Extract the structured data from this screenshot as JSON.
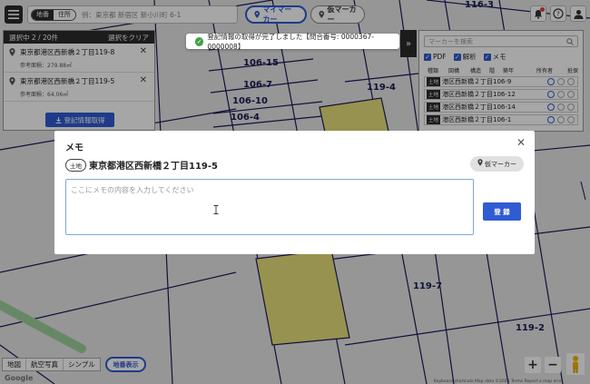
{
  "topbar": {
    "map_toggle": "地番",
    "address_toggle": "住所",
    "search_placeholder": "例：東京都 新宿区 新小川町 6-1",
    "my_marker": "マイマーカー",
    "temp_marker": "仮マーカー"
  },
  "map_labels": [
    "116-3",
    "106-15",
    "106-7",
    "106-10",
    "106-4",
    "119-4",
    "119-7",
    "119-2"
  ],
  "selection_panel": {
    "title": "選択中 2 / 20件",
    "clear": "選択をクリア",
    "items": [
      {
        "address": "東京都港区西新橋２丁目119-8",
        "area": "参考面積：279.88㎡"
      },
      {
        "address": "東京都港区西新橋２丁目119-5",
        "area": "参考面積：64.06㎡"
      }
    ],
    "get_button": "登記情報取得"
  },
  "toast": "登記情報の取得が完了しました【問合番号: 0000367-0000008】",
  "right_panel": {
    "search_placeholder": "マーカーを検索",
    "checks": [
      "PDF",
      "解析",
      "メモ"
    ],
    "columns": [
      "種類",
      "図構",
      "構造",
      "階",
      "築年",
      "所有者",
      "抵保"
    ],
    "rows": [
      {
        "tag": "土地",
        "address": "港区西新橋２丁目106-9"
      },
      {
        "tag": "土地",
        "address": "港区西新橋２丁目106-12"
      },
      {
        "tag": "土地",
        "address": "港区西新橋２丁目106-14"
      },
      {
        "tag": "土地",
        "address": "港区西新橋２丁目106-1"
      }
    ]
  },
  "modal": {
    "title": "メモ",
    "tag": "土地",
    "address": "東京都港区西新橋２丁目119-5",
    "temp_marker": "仮マーカー",
    "placeholder": "ここにメモの内容を入力してください",
    "submit": "登 録"
  },
  "bottom": {
    "map_types": [
      "地図",
      "航空写真",
      "シンプル"
    ],
    "map_display": "地番表示",
    "google": "Google",
    "footer": "Keyboard shortcuts   Map data ©2023   Terms   Report a map error"
  }
}
